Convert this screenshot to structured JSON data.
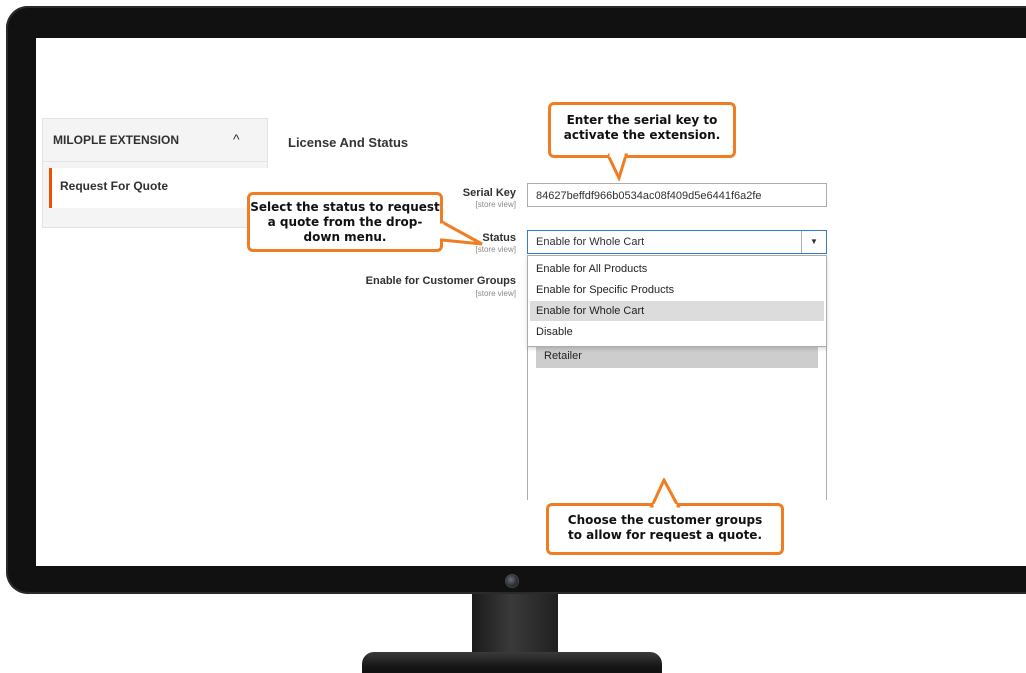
{
  "sidebar": {
    "title": "MILOPLE EXTENSION",
    "chevron_icon": "chevron-up-icon",
    "chevron_glyph": "^",
    "item_label": "Request For Quote"
  },
  "section": {
    "title": "License And Status"
  },
  "fields": {
    "serial_key": {
      "label": "Serial Key",
      "scope": "[store view]",
      "value": "84627beffdf966b0534ac08f409d5e6441f6a2fe"
    },
    "status": {
      "label": "Status",
      "scope": "[store view]",
      "selected": "Enable for Whole Cart",
      "arrow_glyph": "▼",
      "options": [
        "Enable for All Products",
        "Enable for Specific Products",
        "Enable for Whole Cart",
        "Disable"
      ]
    },
    "customer_groups": {
      "label": "Enable for Customer Groups",
      "scope": "[store view]",
      "items": [
        "Retailer"
      ]
    }
  },
  "callouts": {
    "serial": {
      "lines": [
        "Enter the serial key to",
        "activate the extension."
      ]
    },
    "status": {
      "lines": [
        "Select the status to request",
        "a quote from the drop-",
        "down menu."
      ]
    },
    "groups": {
      "lines": [
        "Choose the customer groups",
        "to allow for request a quote."
      ]
    }
  },
  "colors": {
    "accent": "#f07d21",
    "sidebar_active": "#eb5202"
  }
}
